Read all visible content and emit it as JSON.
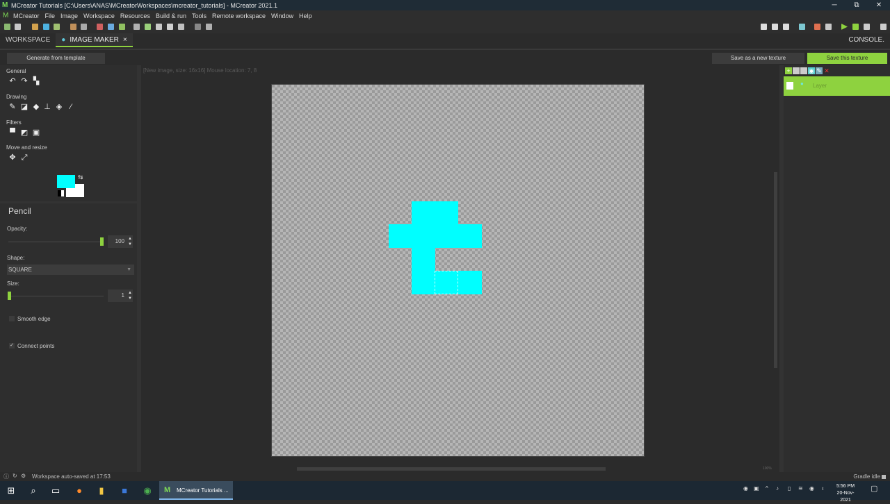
{
  "window": {
    "title": "MCreator Tutorials [C:\\Users\\ANAS\\MCreatorWorkspaces\\mcreator_tutorials] - MCreator 2021.1",
    "minimize": "─",
    "restore": "⧉",
    "close": "✕"
  },
  "menu": [
    "MCreator",
    "File",
    "Image",
    "Workspace",
    "Resources",
    "Build & run",
    "Tools",
    "Remote workspace",
    "Window",
    "Help"
  ],
  "tabs": {
    "workspace": "WORKSPACE",
    "image_maker": "IMAGE MAKER",
    "close": "×",
    "console": "CONSOLE."
  },
  "actions": {
    "generate": "Generate from template",
    "save_new": "Save as a new texture",
    "save_this": "Save this texture"
  },
  "tool_sections": {
    "general": "General",
    "drawing": "Drawing",
    "filters": "Filters",
    "move_resize": "Move and resize"
  },
  "colors": {
    "primary": "#00ffff",
    "secondary": "#ffffff",
    "accent": "#8ed23f"
  },
  "pencil": {
    "title": "Pencil",
    "opacity_label": "Opacity:",
    "opacity_value": "100",
    "opacity_level": 1.0,
    "shape_label": "Shape:",
    "shape_value": "SQUARE",
    "size_label": "Size:",
    "size_value": "1",
    "smooth_edge": "Smooth edge",
    "smooth_checked": false,
    "connect_points": "Connect points",
    "connect_checked": true
  },
  "canvas": {
    "info": "[New image, size: 16x16] Mouse location: 7, 8",
    "zoom": "100%"
  },
  "layers": {
    "name": "Layer"
  },
  "status": {
    "autosave": "Workspace auto-saved at 17:53",
    "gradle": "Gradle idle"
  },
  "taskbar": {
    "app_label": "MCreator Tutorials ...",
    "time": "5:56 PM",
    "date": "20-Nov-2021"
  }
}
